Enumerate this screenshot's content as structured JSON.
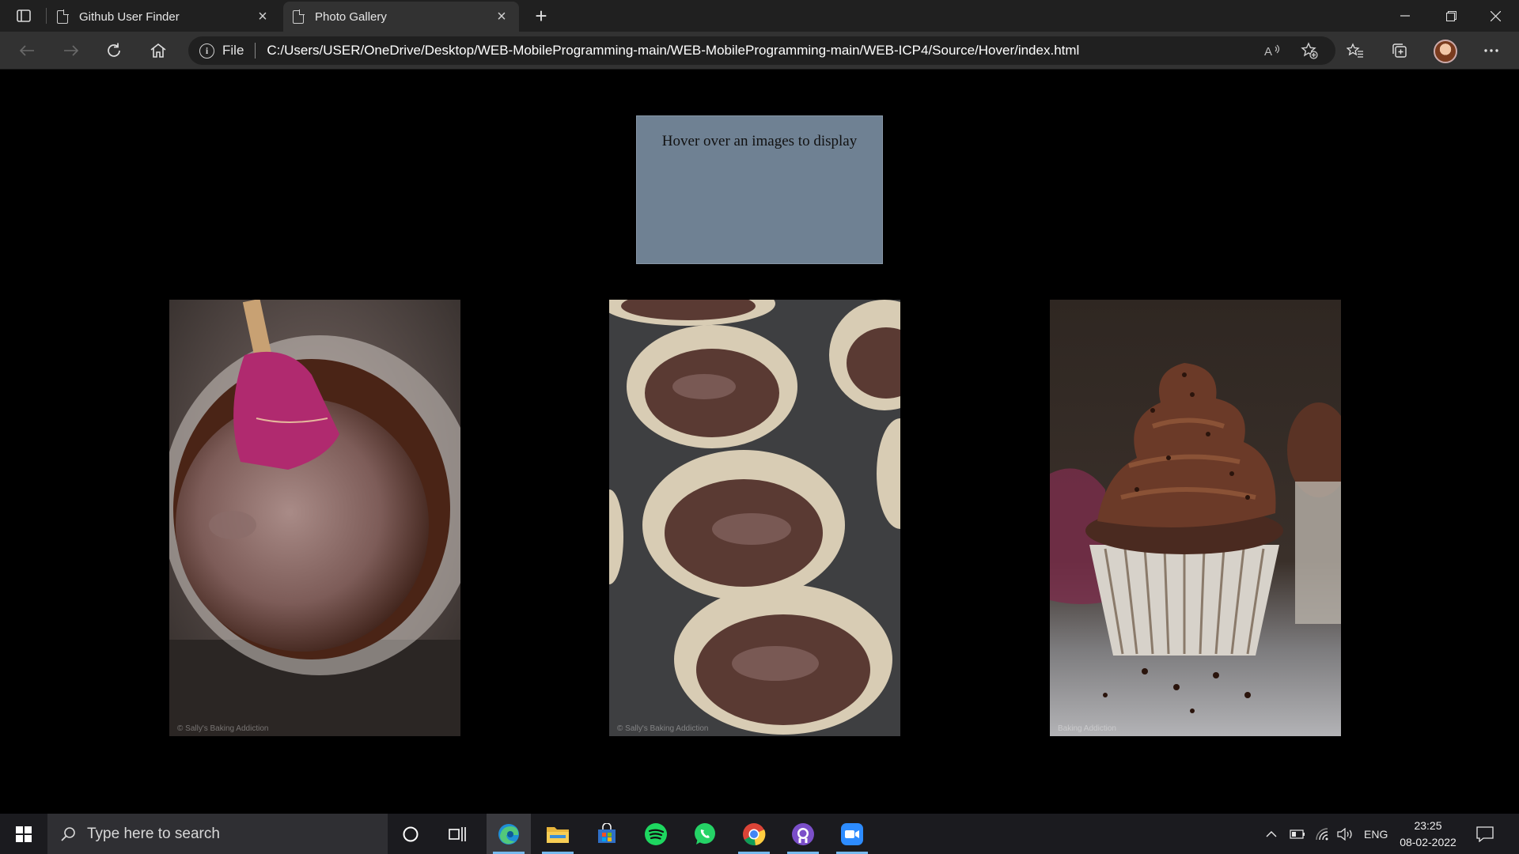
{
  "browser": {
    "tabs": [
      {
        "label": "Github User Finder",
        "active": false
      },
      {
        "label": "Photo Gallery",
        "active": true
      }
    ],
    "new_tab_symbol": "+",
    "close_symbol": "×",
    "address": {
      "scheme": "File",
      "url": "C:/Users/USER/OneDrive/Desktop/WEB-MobileProgramming-main/WEB-MobileProgramming-main/WEB-ICP4/Source/Hover/index.html"
    },
    "window_controls": [
      "minimize",
      "restore",
      "close"
    ]
  },
  "page": {
    "display_text": "Hover over an images to display",
    "background_color": "#000000",
    "display_box_color": "#6f8193",
    "images": [
      {
        "name": "chocolate-batter-bowl",
        "watermark": "© Sally's Baking Addiction"
      },
      {
        "name": "cupcake-liners-in-tin",
        "watermark": "© Sally's Baking Addiction"
      },
      {
        "name": "chocolate-frosted-cupcake",
        "watermark": "Baking Addiction"
      }
    ]
  },
  "taskbar": {
    "search_placeholder": "Type here to search",
    "apps": [
      "cortana-icon",
      "task-view-icon",
      "edge-icon",
      "file-explorer-icon",
      "microsoft-store-icon",
      "spotify-icon",
      "whatsapp-icon",
      "chrome-icon",
      "github-desktop-icon",
      "zoom-icon"
    ],
    "active_app": "edge-icon",
    "tray": {
      "language": "ENG",
      "time": "23:25",
      "date": "08-02-2022"
    },
    "accent_color": "#76b9ed"
  }
}
